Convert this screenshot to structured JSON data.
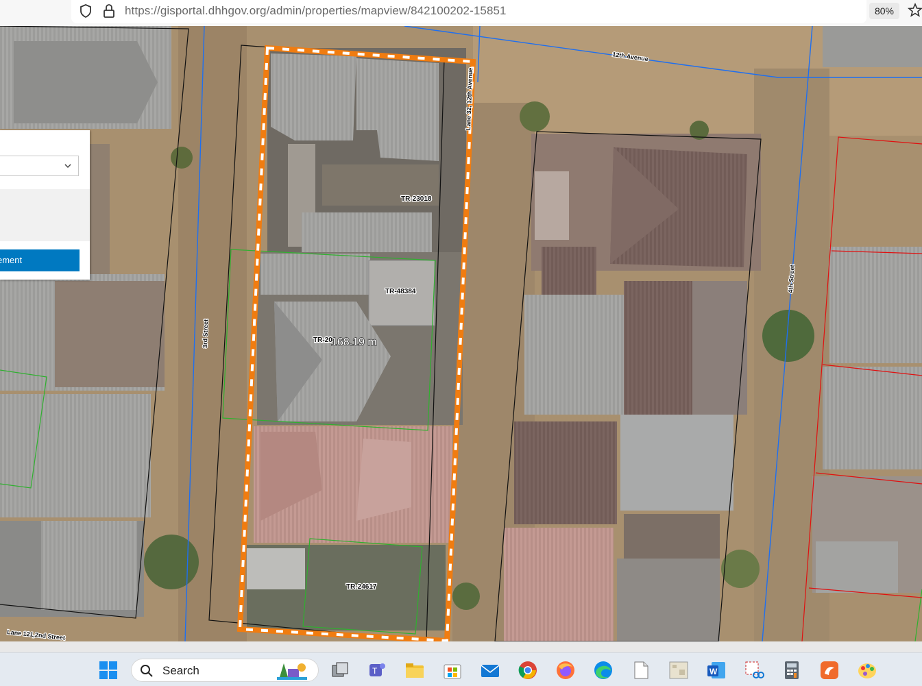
{
  "browser": {
    "url": "https://gisportal.dhhgov.org/admin/properties/mapview/842100202-15851",
    "zoom": "80%"
  },
  "panel": {
    "button_label": "ement"
  },
  "map": {
    "streets": {
      "avenue_12": "12th Avenue",
      "lane_32": "Lane 32, 12th Avenue",
      "street_3": "3rd Street",
      "street_4": "4th Street",
      "lane_121": "Lane 121,2nd Street"
    },
    "parcels": {
      "p1": "TR-23018",
      "p2": "TR-48384",
      "p3": "TR-20",
      "p4": "TR-24617"
    },
    "measurement": "168.19 m",
    "colors": {
      "selection_outline": "#f07c10",
      "road_lines": "#1e6ff0",
      "parcel_black": "#111111",
      "parcel_green": "#2fb02f",
      "parcel_red": "#e01010"
    }
  },
  "taskbar": {
    "search_label": "Search",
    "icons": [
      "windows-start",
      "task-view",
      "teams",
      "file-explorer",
      "store",
      "mail",
      "chrome",
      "firefox",
      "edge",
      "notepad",
      "image-viewer",
      "word",
      "snipping-tool",
      "calculator",
      "app",
      "paint"
    ]
  }
}
